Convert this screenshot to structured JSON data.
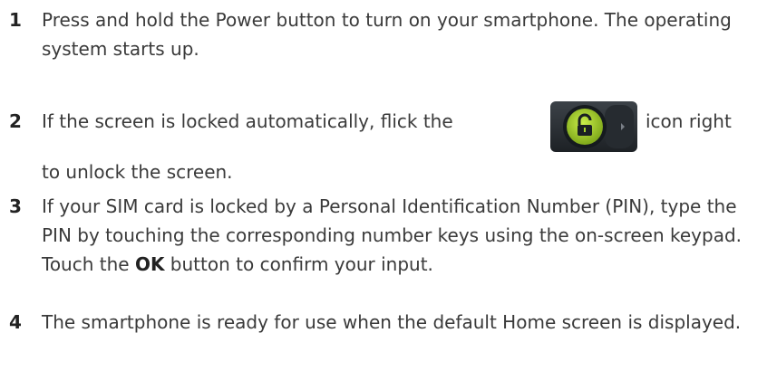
{
  "steps": [
    {
      "number": "1",
      "text": "Press and hold the Power button to turn on your smartphone. The operating system starts up."
    },
    {
      "number": "2",
      "text_before": "If the screen is locked automatically, flick the",
      "icon": "unlock-slider-icon",
      "text_after_icon": "icon right",
      "text_continuation": "to unlock the screen."
    },
    {
      "number": "3",
      "text_before": "If your SIM card is locked by a Personal Identification Number (PIN), type the PIN by touching the corresponding number keys using the on-screen keypad. Touch the ",
      "bold": "OK",
      "text_after": " button to confirm your input."
    },
    {
      "number": "4",
      "text": "The smartphone is ready for use when the default Home screen is displayed."
    }
  ],
  "colors": {
    "text": "#3a3a3a",
    "icon_bg": "#2b3035",
    "icon_green": "#a6d12a"
  }
}
